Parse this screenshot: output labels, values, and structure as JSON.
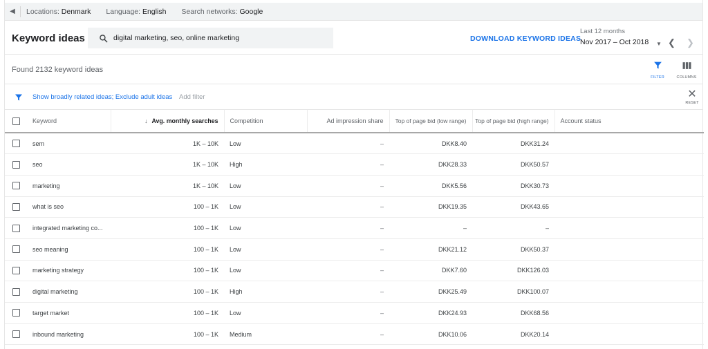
{
  "topbar": {
    "locations_label": "Locations:",
    "locations_value": "Denmark",
    "language_label": "Language:",
    "language_value": "English",
    "networks_label": "Search networks:",
    "networks_value": "Google"
  },
  "header": {
    "title": "Keyword ideas",
    "search_value": "digital marketing, seo, online marketing",
    "download_label": "DOWNLOAD KEYWORD IDEAS",
    "date_label": "Last 12 months",
    "date_value": "Nov 2017 – Oct 2018"
  },
  "summary": {
    "found_text": "Found 2132 keyword ideas",
    "filter_caption": "FILTER",
    "columns_caption": "COLUMNS"
  },
  "filterbar": {
    "filter_text": "Show broadly related ideas; Exclude adult ideas",
    "add_filter": "Add filter",
    "reset_caption": "RESET"
  },
  "colors": {
    "accent": "#1a73e8",
    "topbar_bg": "#f1f3f4"
  },
  "table": {
    "headers": {
      "keyword": "Keyword",
      "avg": "Avg. monthly searches",
      "competition": "Competition",
      "impression": "Ad impression share",
      "bid_low": "Top of page bid (low range)",
      "bid_high": "Top of page bid (high range)",
      "status": "Account status"
    },
    "rows": [
      {
        "keyword": "sem",
        "avg": "1K – 10K",
        "competition": "Low",
        "impression": "–",
        "bid_low": "DKK8.40",
        "bid_high": "DKK31.24",
        "status": ""
      },
      {
        "keyword": "seo",
        "avg": "1K – 10K",
        "competition": "High",
        "impression": "–",
        "bid_low": "DKK28.33",
        "bid_high": "DKK50.57",
        "status": ""
      },
      {
        "keyword": "marketing",
        "avg": "1K – 10K",
        "competition": "Low",
        "impression": "–",
        "bid_low": "DKK5.56",
        "bid_high": "DKK30.73",
        "status": ""
      },
      {
        "keyword": "what is seo",
        "avg": "100 – 1K",
        "competition": "Low",
        "impression": "–",
        "bid_low": "DKK19.35",
        "bid_high": "DKK43.65",
        "status": ""
      },
      {
        "keyword": "integrated marketing co...",
        "avg": "100 – 1K",
        "competition": "Low",
        "impression": "–",
        "bid_low": "–",
        "bid_high": "–",
        "status": ""
      },
      {
        "keyword": "seo meaning",
        "avg": "100 – 1K",
        "competition": "Low",
        "impression": "–",
        "bid_low": "DKK21.12",
        "bid_high": "DKK50.37",
        "status": ""
      },
      {
        "keyword": "marketing strategy",
        "avg": "100 – 1K",
        "competition": "Low",
        "impression": "–",
        "bid_low": "DKK7.60",
        "bid_high": "DKK126.03",
        "status": ""
      },
      {
        "keyword": "digital marketing",
        "avg": "100 – 1K",
        "competition": "High",
        "impression": "–",
        "bid_low": "DKK25.49",
        "bid_high": "DKK100.07",
        "status": ""
      },
      {
        "keyword": "target market",
        "avg": "100 – 1K",
        "competition": "Low",
        "impression": "–",
        "bid_low": "DKK24.93",
        "bid_high": "DKK68.56",
        "status": ""
      },
      {
        "keyword": "inbound marketing",
        "avg": "100 – 1K",
        "competition": "Medium",
        "impression": "–",
        "bid_low": "DKK10.06",
        "bid_high": "DKK20.14",
        "status": ""
      }
    ]
  }
}
